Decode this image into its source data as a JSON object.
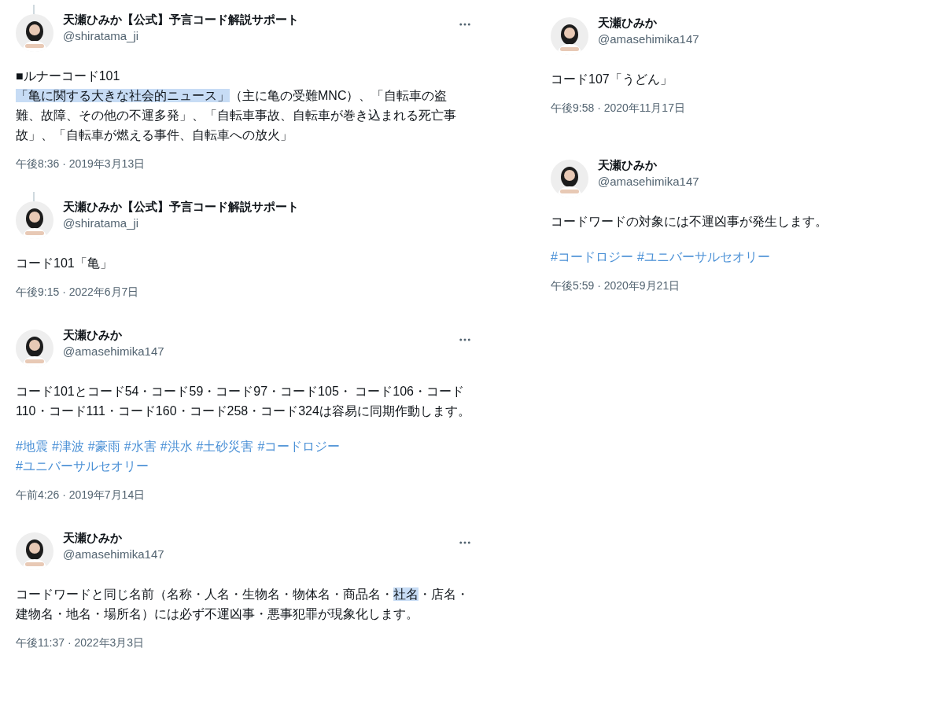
{
  "columns": [
    {
      "tweets": [
        {
          "thread_line": true,
          "menu": true,
          "name": "天瀬ひみか【公式】予言コード解説サポート",
          "handle": "@shiratama_ji",
          "paragraphs": [
            [
              {
                "text": "■ルナーコード101",
                "highlighted": false
              }
            ],
            [
              {
                "text": "「亀に関する大きな社会的ニュース」",
                "highlighted": true
              },
              {
                "text": "（主に亀の受難MNC）、「自転車の盗難、故障、その他の不運多発」、「自転車事故、自転車が巻き込まれる死亡事故」、「自転車が燃える事件、自転車への放火」",
                "highlighted": false
              }
            ]
          ],
          "time": "午後8:36 · 2019年3月13日"
        },
        {
          "thread_line": true,
          "menu": false,
          "name": "天瀬ひみか【公式】予言コード解説サポート",
          "handle": "@shiratama_ji",
          "paragraphs": [
            [
              {
                "text": "コード101「亀」",
                "highlighted": false
              }
            ]
          ],
          "time": "午後9:15 · 2022年6月7日"
        },
        {
          "thread_line": false,
          "menu": true,
          "name": "天瀬ひみか",
          "handle": "@amasehimika147",
          "paragraphs": [
            [
              {
                "text": "コード101とコード54・コード59・コード97・コード105・ コード106・コード110・コード111・コード160・コード258・コード324は容易に同期作動します。",
                "highlighted": false
              }
            ]
          ],
          "hashtags": [
            "#地震",
            "#津波",
            "#豪雨",
            "#水害",
            "#洪水",
            "#土砂災害",
            "#コードロジー",
            "#ユニバーサルセオリー"
          ],
          "time": "午前4:26 · 2019年7月14日"
        },
        {
          "thread_line": false,
          "menu": true,
          "name": "天瀬ひみか",
          "handle": "@amasehimika147",
          "paragraphs": [
            [
              {
                "text": "コードワードと同じ名前（名称・人名・生物名・物体名・商品名・",
                "highlighted": false
              },
              {
                "text": "社名",
                "highlighted": true
              },
              {
                "text": "・店名・建物名・地名・場所名）には必ず不運凶事・悪事犯罪が現象化します。",
                "highlighted": false
              }
            ]
          ],
          "time": "午後11:37 · 2022年3月3日"
        }
      ]
    },
    {
      "tweets": [
        {
          "thread_line": false,
          "menu": false,
          "name": "天瀬ひみか",
          "handle": "@amasehimika147",
          "paragraphs": [
            [
              {
                "text": "コード107「うどん」",
                "highlighted": false
              }
            ]
          ],
          "time": "午後9:58 · 2020年11月17日"
        },
        {
          "thread_line": false,
          "menu": false,
          "name": "天瀬ひみか",
          "handle": "@amasehimika147",
          "paragraphs": [
            [
              {
                "text": "コードワードの対象には不運凶事が発生します。",
                "highlighted": false
              }
            ]
          ],
          "hashtags": [
            "#コードロジー",
            "#ユニバーサルセオリー"
          ],
          "time": "午後5:59 · 2020年9月21日"
        }
      ]
    }
  ]
}
